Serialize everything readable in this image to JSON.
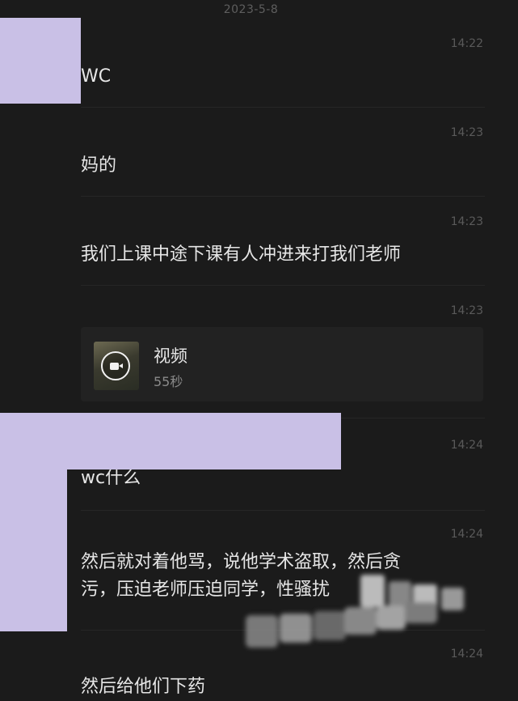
{
  "conversation": {
    "date": "2023-5-8"
  },
  "messages": [
    {
      "time": "14:22",
      "text": "WC"
    },
    {
      "time": "14:23",
      "text": "妈的"
    },
    {
      "time": "14:23",
      "text": "我们上课中途下课有人冲进来打我们老师"
    },
    {
      "time": "14:23",
      "type": "video",
      "title": "视频",
      "duration": "55秒"
    },
    {
      "time": "14:24",
      "text": "wc什么"
    },
    {
      "time": "14:24",
      "lines": [
        "然后就对着他骂，说他学术盗取，然后贪",
        "污，压迫老师压迫同学，性骚扰"
      ]
    },
    {
      "time": "14:24",
      "text": "然后给他们下药"
    }
  ],
  "colors": {
    "background": "#1b1b1b",
    "text": "#e6e6e6",
    "timestamp": "#5a5a5a",
    "redaction": "#c9c0e6"
  },
  "icons": {
    "video_thumbnail": "video-camera-icon"
  }
}
